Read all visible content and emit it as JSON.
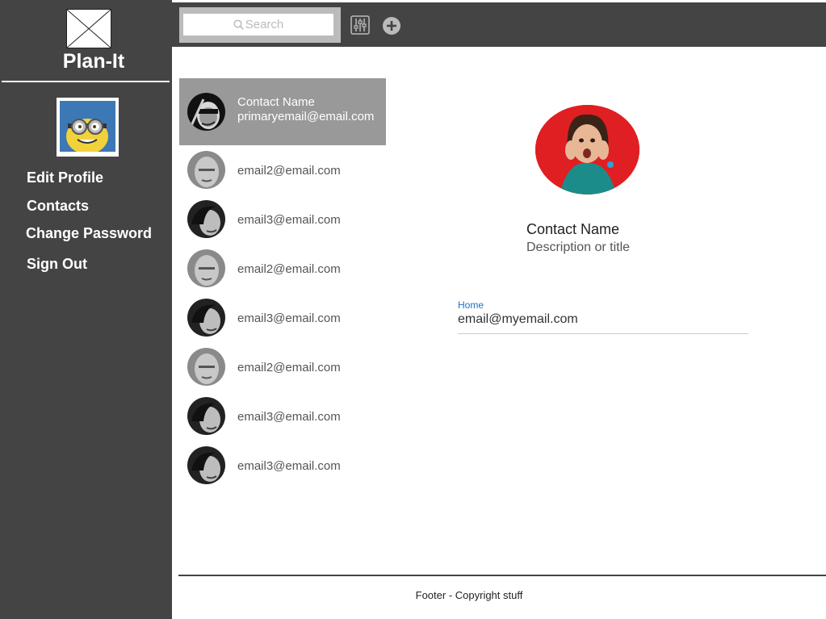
{
  "app": {
    "title": "Plan-It"
  },
  "sidebar": {
    "nav": [
      {
        "label": "Edit Profile"
      },
      {
        "label": "Contacts"
      },
      {
        "label": "Change Password"
      },
      {
        "label": "Sign Out"
      }
    ]
  },
  "toolbar": {
    "search_placeholder": "Search",
    "icons": [
      "search-icon",
      "filter-sliders-icon",
      "add-icon"
    ]
  },
  "contacts": {
    "selected": {
      "name": "Contact Name",
      "email": "primaryemail@email.com"
    },
    "list": [
      {
        "email": "email2@email.com"
      },
      {
        "email": "email3@email.com"
      },
      {
        "email": "email2@email.com"
      },
      {
        "email": "email3@email.com"
      },
      {
        "email": "email2@email.com"
      },
      {
        "email": "email3@email.com"
      },
      {
        "email": "email3@email.com"
      }
    ]
  },
  "detail": {
    "name": "Contact Name",
    "title": "Description or title",
    "field_label": "Home",
    "field_value": "email@myemail.com"
  },
  "footer": {
    "text": "Footer - Copyright stuff"
  },
  "colors": {
    "sidebar_bg": "#444444",
    "selected_row_bg": "#999999",
    "field_label": "#1a73c8",
    "photo_bg": "#e01f22"
  }
}
